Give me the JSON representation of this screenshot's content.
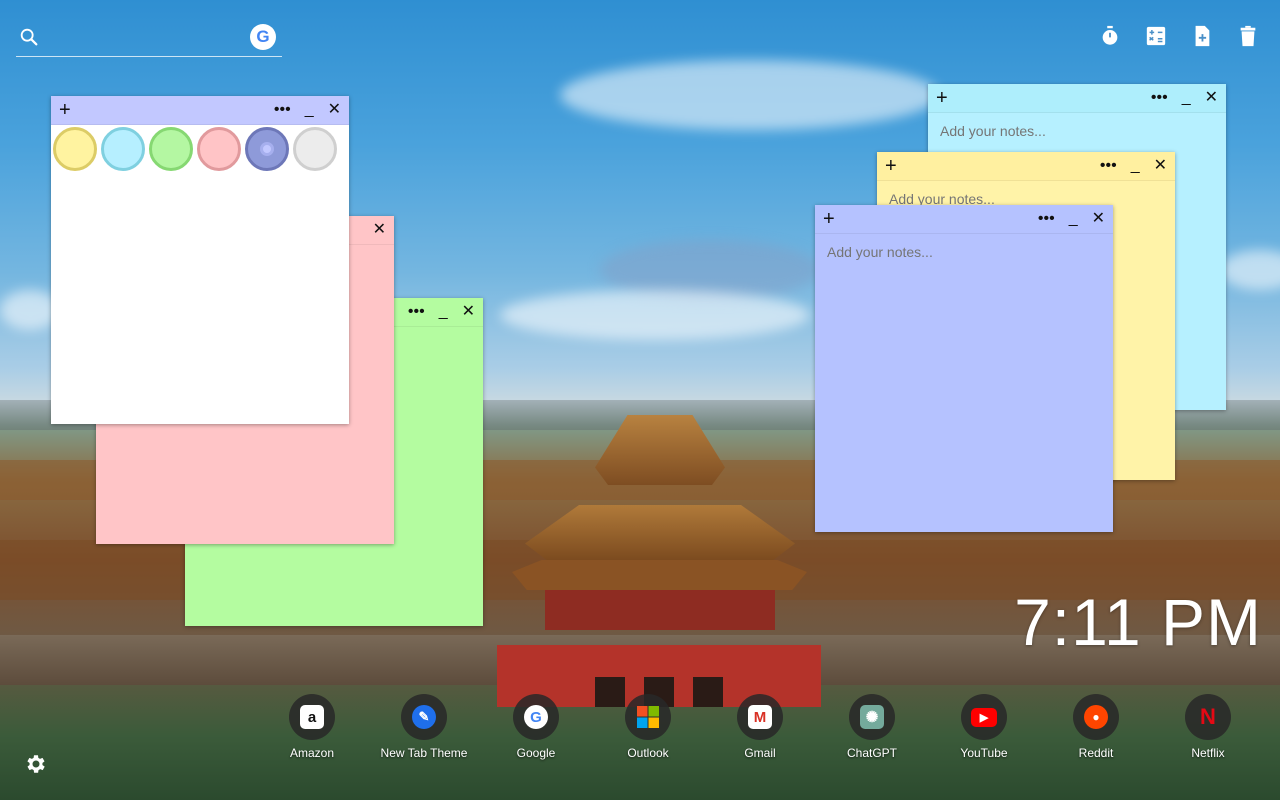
{
  "search": {
    "placeholder": "",
    "engine_icon": "google-icon",
    "engine_letter": "G"
  },
  "toolbar": {
    "icons": [
      "stopwatch-icon",
      "calculator-icon",
      "add-note-icon",
      "trash-icon"
    ]
  },
  "notes": [
    {
      "color": "#b6f0ff",
      "placeholder": "Add your notes...",
      "controls": [
        "+",
        "•••",
        "_",
        "✕"
      ]
    },
    {
      "color": "#fff3a8",
      "placeholder": "Add your notes...",
      "controls": [
        "+",
        "•••",
        "_",
        "✕"
      ]
    },
    {
      "color": "#b5c2ff",
      "placeholder": "Add your notes...",
      "controls": [
        "+",
        "•••",
        "_",
        "✕"
      ]
    },
    {
      "color": "#ffc5c7",
      "placeholder": "",
      "controls": [
        "✕"
      ]
    },
    {
      "color": "#b4fca0",
      "placeholder": "",
      "controls": [
        "•••",
        "_",
        "✕"
      ]
    },
    {
      "color": "#ffffff",
      "placeholder": "",
      "controls": [
        "+",
        "•••",
        "_",
        "✕"
      ]
    }
  ],
  "color_picker": {
    "swatches": [
      "#fff3a0",
      "#b6efff",
      "#b4f7a2",
      "#ffc4c6",
      "#8e9ad9",
      "#ececec"
    ],
    "selected": "#8e9ad9"
  },
  "clock": {
    "time": "7:11 PM"
  },
  "shortcuts": [
    {
      "label": "Amazon",
      "icon": "amazon-icon",
      "glyph": "a",
      "bg": "#ffffff",
      "fg": "#111111"
    },
    {
      "label": "New Tab Theme",
      "icon": "new-tab-theme-icon",
      "glyph": "✎",
      "bg": "#1f6feb",
      "fg": "#ffffff"
    },
    {
      "label": "Google",
      "icon": "google-icon",
      "glyph": "G",
      "bg": "#ffffff",
      "fg": "#4285f4"
    },
    {
      "label": "Outlook",
      "icon": "microsoft-icon",
      "glyph": "",
      "bg": "transparent",
      "fg": "#ffffff"
    },
    {
      "label": "Gmail",
      "icon": "gmail-icon",
      "glyph": "M",
      "bg": "#ffffff",
      "fg": "#d93025"
    },
    {
      "label": "ChatGPT",
      "icon": "chatgpt-icon",
      "glyph": "✺",
      "bg": "#74aa9c",
      "fg": "#ffffff"
    },
    {
      "label": "YouTube",
      "icon": "youtube-icon",
      "glyph": "▶",
      "bg": "#ff0000",
      "fg": "#ffffff"
    },
    {
      "label": "Reddit",
      "icon": "reddit-icon",
      "glyph": "●",
      "bg": "#ff4500",
      "fg": "#ffffff"
    },
    {
      "label": "Netflix",
      "icon": "netflix-icon",
      "glyph": "N",
      "bg": "transparent",
      "fg": "#e50914"
    }
  ],
  "settings": {
    "icon": "gear-icon"
  }
}
